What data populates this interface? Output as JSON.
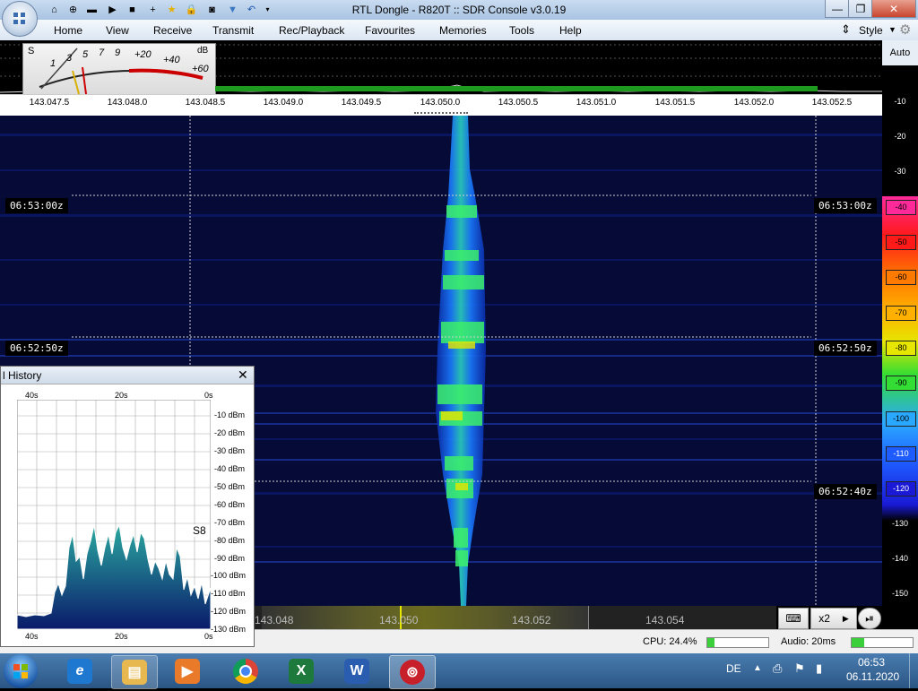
{
  "window": {
    "title": "RTL Dongle - R820T :: SDR Console v3.0.19",
    "controls": [
      "minimize-icon",
      "maximize-icon",
      "close-icon"
    ]
  },
  "quick_access": [
    "home-icon",
    "help-icon",
    "folder-icon",
    "play-icon",
    "stop-icon",
    "add-icon",
    "favourite-star-icon",
    "lock-icon",
    "camera-icon",
    "filter-icon",
    "undo-icon",
    "dropdown-icon"
  ],
  "menu": {
    "items": [
      "Home",
      "View",
      "Receive",
      "Transmit",
      "Rec/Playback",
      "Favourites",
      "Memories",
      "Tools",
      "Help"
    ],
    "style_label": "Style"
  },
  "smeter": {
    "s_label": "S",
    "db_label": "dB",
    "s_ticks": [
      "1",
      "3",
      "5",
      "7",
      "9"
    ],
    "db_ticks": [
      "+20",
      "+40",
      "+60"
    ],
    "needle_reading": "S3"
  },
  "frequency_scale": [
    "143.047.5",
    "143.048.0",
    "143.048.5",
    "143.049.0",
    "143.049.5",
    "143.050.0",
    "143.050.5",
    "143.051.0",
    "143.051.5",
    "143.052.0",
    "143.052.5"
  ],
  "waterfall": {
    "time_labels": [
      "06:53:00z",
      "06:52:50z",
      "06:52:40z"
    ]
  },
  "db_scale": {
    "auto_label": "Auto",
    "levels": [
      "-10",
      "-20",
      "-30",
      "-40",
      "-50",
      "-60",
      "-70",
      "-80",
      "-90",
      "-100",
      "-110",
      "-120",
      "-130",
      "-140",
      "-150"
    ],
    "colors": {
      "-40": "#ff2a9a",
      "-50": "#ff1a1a",
      "-60": "#ff7a00",
      "-70": "#ffb000",
      "-80": "#e6e600",
      "-90": "#33dd33",
      "-100": "#2aa8ff",
      "-110": "#1e5cff",
      "-120": "#1a1ad6"
    }
  },
  "band_plan": {
    "labels": [
      "143.048",
      "143.050",
      "143.052",
      "143.054"
    ],
    "zoom_label": "x2"
  },
  "status": {
    "cpu": "CPU: 24.4%",
    "cpu_level": 0.12,
    "audio": "Audio: 20ms",
    "audio_level": 0.2
  },
  "history_panel": {
    "title": "l History",
    "top_axis": [
      "40s",
      "20s",
      "0s"
    ],
    "bottom_axis": [
      "40s",
      "20s",
      "0s"
    ],
    "y_labels": [
      "-10 dBm",
      "-20 dBm",
      "-30 dBm",
      "-40 dBm",
      "-50 dBm",
      "-60 dBm",
      "-70 dBm",
      "-80 dBm",
      "-90 dBm",
      "-100 dBm",
      "-110 dBm",
      "-120 dBm",
      "-130 dBm"
    ],
    "s_readout": "S8"
  },
  "taskbar": {
    "apps": [
      "ie-icon",
      "explorer-icon",
      "media-player-icon",
      "chrome-icon",
      "excel-icon",
      "word-icon",
      "sdr-console-icon"
    ],
    "language": "DE",
    "time": "06:53",
    "date": "06.11.2020"
  }
}
